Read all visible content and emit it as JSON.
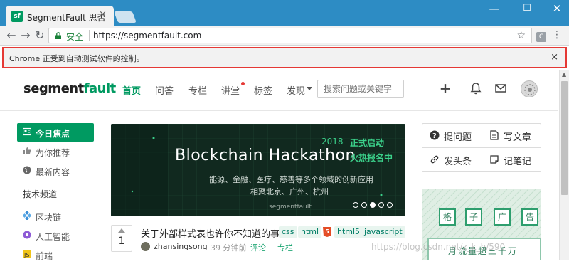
{
  "browser": {
    "tab_title": "SegmentFault 思否",
    "tab_favicon": "sf",
    "tab_close": "×",
    "window_minimize": "—",
    "window_maximize": "☐",
    "window_close": "✕",
    "secure_label": "安全",
    "url": "https://segmentfault.com",
    "infobar_text": "Chrome 正受到自动测试软件的控制。",
    "infobar_close": "×"
  },
  "site": {
    "logo_prefix": "segment",
    "logo_suffix": "fault",
    "nav": [
      "首页",
      "问答",
      "专栏",
      "讲堂",
      "标签",
      "发现"
    ],
    "search_placeholder": "搜索问题或关键字",
    "accent": "#009a61"
  },
  "sidebar": {
    "items": [
      "今日焦点",
      "为你推荐",
      "最新内容"
    ],
    "channel_heading": "技术频道",
    "channels": [
      "区块链",
      "人工智能",
      "前端"
    ]
  },
  "banner": {
    "title": "Blockchain Hackathon",
    "year": "2018",
    "tag1": "正式启动",
    "tag2": "火热报名中",
    "subtitle1": "能源、金融、医疗、慈善等多个领域的创新应用",
    "subtitle2": "相聚北京、广州、杭州",
    "brand": "segmentfault",
    "slide_count": 5,
    "active_slide": 3
  },
  "question": {
    "votes": "1",
    "title": "关于外部样式表也许你不知道的事",
    "tags": [
      "css",
      "html",
      "html5",
      "javascript"
    ],
    "author": "zhansingsong",
    "time": "39 分钟前",
    "comments_label": "评论",
    "column_label": "专栏"
  },
  "actions": [
    "提问题",
    "写文章",
    "发头条",
    "记笔记"
  ],
  "ad": {
    "chars": [
      "格",
      "子",
      "广",
      "告"
    ],
    "text": "月流量超三千万"
  },
  "watermark": "https://blog.csdn.net/z_k_h/590"
}
